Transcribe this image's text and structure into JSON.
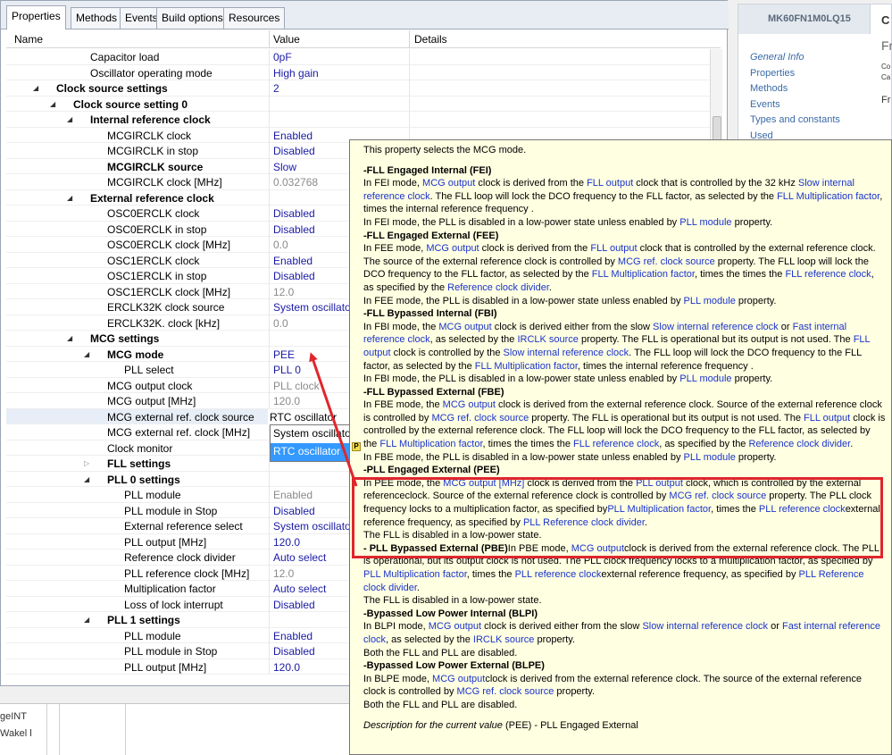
{
  "tabs": [
    "Properties",
    "Methods",
    "Events",
    "Build options",
    "Resources"
  ],
  "columns": {
    "name": "Name",
    "value": "Value",
    "details": "Details"
  },
  "rows": [
    {
      "name": "Capacitor load",
      "value": "0pF",
      "indent": 96,
      "tri": "",
      "bold": false,
      "gray": false
    },
    {
      "name": "Oscillator operating mode",
      "value": "High gain",
      "indent": 96,
      "tri": "",
      "bold": false,
      "gray": false
    },
    {
      "name": "Clock source settings",
      "value": "2",
      "indent": 58,
      "tri": "open",
      "bold": true,
      "gray": false
    },
    {
      "name": "Clock source setting 0",
      "value": "",
      "indent": 77,
      "tri": "open",
      "bold": true,
      "gray": false
    },
    {
      "name": "Internal reference clock",
      "value": "",
      "indent": 96,
      "tri": "open",
      "bold": true,
      "gray": false
    },
    {
      "name": "MCGIRCLK clock",
      "value": "Enabled",
      "indent": 115,
      "tri": "",
      "bold": false,
      "gray": false
    },
    {
      "name": "MCGIRCLK in stop",
      "value": "Disabled",
      "indent": 115,
      "tri": "",
      "bold": false,
      "gray": false
    },
    {
      "name": "MCGIRCLK source",
      "value": "Slow",
      "indent": 115,
      "tri": "",
      "bold": true,
      "gray": false
    },
    {
      "name": "MCGIRCLK clock [MHz]",
      "value": "0.032768",
      "indent": 115,
      "tri": "",
      "bold": false,
      "gray": true
    },
    {
      "name": "External reference clock",
      "value": "",
      "indent": 96,
      "tri": "open",
      "bold": true,
      "gray": false
    },
    {
      "name": "OSC0ERCLK clock",
      "value": "Disabled",
      "indent": 115,
      "tri": "",
      "bold": false,
      "gray": false
    },
    {
      "name": "OSC0ERCLK in stop",
      "value": "Disabled",
      "indent": 115,
      "tri": "",
      "bold": false,
      "gray": false
    },
    {
      "name": "OSC0ERCLK clock [MHz]",
      "value": "0.0",
      "indent": 115,
      "tri": "",
      "bold": false,
      "gray": true
    },
    {
      "name": "OSC1ERCLK clock",
      "value": "Enabled",
      "indent": 115,
      "tri": "",
      "bold": false,
      "gray": false
    },
    {
      "name": "OSC1ERCLK in stop",
      "value": "Disabled",
      "indent": 115,
      "tri": "",
      "bold": false,
      "gray": false
    },
    {
      "name": "OSC1ERCLK clock [MHz]",
      "value": "12.0",
      "indent": 115,
      "tri": "",
      "bold": false,
      "gray": true
    },
    {
      "name": "ERCLK32K clock source",
      "value": "System oscillator",
      "indent": 115,
      "tri": "",
      "bold": false,
      "gray": false
    },
    {
      "name": "ERCLK32K. clock [kHz]",
      "value": "0.0",
      "indent": 115,
      "tri": "",
      "bold": false,
      "gray": true
    },
    {
      "name": "MCG settings",
      "value": "",
      "indent": 96,
      "tri": "open",
      "bold": true,
      "gray": false
    },
    {
      "name": "MCG mode",
      "value": "PEE",
      "indent": 115,
      "tri": "open",
      "bold": true,
      "gray": false
    },
    {
      "name": "PLL select",
      "value": "PLL 0",
      "indent": 134,
      "tri": "",
      "bold": false,
      "gray": false
    },
    {
      "name": "MCG output clock",
      "value": "PLL clock",
      "indent": 115,
      "tri": "",
      "bold": false,
      "gray": true
    },
    {
      "name": "MCG output [MHz]",
      "value": "120.0",
      "indent": 115,
      "tri": "",
      "bold": false,
      "gray": true
    },
    {
      "name": "MCG external ref. clock source",
      "value": "",
      "indent": 115,
      "tri": "",
      "bold": false,
      "gray": false
    },
    {
      "name": "MCG external ref. clock [MHz]",
      "value": "",
      "indent": 115,
      "tri": "",
      "bold": false,
      "gray": false
    },
    {
      "name": "Clock monitor",
      "value": "",
      "indent": 115,
      "tri": "",
      "bold": false,
      "gray": false
    },
    {
      "name": "FLL settings",
      "value": "",
      "indent": 115,
      "tri": "closed",
      "bold": true,
      "gray": false
    },
    {
      "name": "PLL 0 settings",
      "value": "",
      "indent": 115,
      "tri": "open",
      "bold": true,
      "gray": false
    },
    {
      "name": "PLL module",
      "value": "Enabled",
      "indent": 134,
      "tri": "",
      "bold": false,
      "gray": true
    },
    {
      "name": "PLL module in Stop",
      "value": "Disabled",
      "indent": 134,
      "tri": "",
      "bold": false,
      "gray": false
    },
    {
      "name": "External reference select",
      "value": "System oscillator",
      "indent": 134,
      "tri": "",
      "bold": false,
      "gray": false
    },
    {
      "name": "PLL output [MHz]",
      "value": "120.0",
      "indent": 134,
      "tri": "",
      "bold": false,
      "gray": false
    },
    {
      "name": "Reference clock divider",
      "value": "Auto select",
      "indent": 134,
      "tri": "",
      "bold": false,
      "gray": false
    },
    {
      "name": "PLL reference clock [MHz]",
      "value": "12.0",
      "indent": 134,
      "tri": "",
      "bold": false,
      "gray": true
    },
    {
      "name": "Multiplication factor",
      "value": "Auto select",
      "indent": 134,
      "tri": "",
      "bold": false,
      "gray": false
    },
    {
      "name": "Loss of lock interrupt",
      "value": "Disabled",
      "indent": 134,
      "tri": "",
      "bold": false,
      "gray": false
    },
    {
      "name": "PLL 1 settings",
      "value": "",
      "indent": 115,
      "tri": "open",
      "bold": true,
      "gray": false
    },
    {
      "name": "PLL module",
      "value": "Enabled",
      "indent": 134,
      "tri": "",
      "bold": false,
      "gray": false
    },
    {
      "name": "PLL module in Stop",
      "value": "Disabled",
      "indent": 134,
      "tri": "",
      "bold": false,
      "gray": false
    },
    {
      "name": "PLL output [MHz]",
      "value": "120.0",
      "indent": 134,
      "tri": "",
      "bold": false,
      "gray": false
    }
  ],
  "editor": {
    "current": "RTC oscillator",
    "options": [
      "System oscillator",
      "RTC oscillator"
    ]
  },
  "bottom_panel": {
    "line1": "geINT",
    "line2": "Wakel l"
  },
  "right_panel": {
    "component": "MK60FN1M0LQ15",
    "tab_initial": "C",
    "right_text": [
      "Fr",
      "Co",
      "Ca",
      "Fr"
    ],
    "links": [
      "General Info",
      "Properties",
      "Methods",
      "Events",
      "Types and constants",
      "Used"
    ]
  },
  "tooltip": {
    "badge": "P",
    "intro": "This property selects the MCG mode.",
    "footer_label": "Description for the current value",
    "footer_value": " (PEE) - PLL Engaged External",
    "sections": [
      {
        "title": "-FLL Engaged Internal (FEI)",
        "inline": false,
        "body": [
          [
            {
              "t": "In FEI mode, "
            },
            {
              "t": "MCG output",
              "l": 1
            },
            {
              "t": " clock is derived from the "
            },
            {
              "t": "FLL output",
              "l": 1
            },
            {
              "t": " clock that is controlled by the 32 kHz "
            },
            {
              "t": "Slow internal reference clock",
              "l": 1
            },
            {
              "t": ". The FLL loop will lock the DCO frequency to the FLL factor, as selected by the "
            },
            {
              "t": "FLL Multiplication factor",
              "l": 1
            },
            {
              "t": ", times the internal reference frequency ."
            }
          ],
          [
            {
              "t": "In FEI mode, the PLL is disabled in a low-power state unless enabled by "
            },
            {
              "t": "PLL module",
              "l": 1
            },
            {
              "t": " property."
            }
          ]
        ]
      },
      {
        "title": "-FLL Engaged External (FEE)",
        "inline": false,
        "body": [
          [
            {
              "t": "In FEE mode, "
            },
            {
              "t": "MCG output",
              "l": 1
            },
            {
              "t": " clock is derived from the "
            },
            {
              "t": "FLL output",
              "l": 1
            },
            {
              "t": " clock that is controlled by the external reference clock. The source of the external reference clock is controlled by "
            },
            {
              "t": "MCG ref. clock source",
              "l": 1
            },
            {
              "t": " property. The FLL loop will lock the DCO frequency to the FLL factor, as selected by the "
            },
            {
              "t": "FLL Multiplication factor",
              "l": 1
            },
            {
              "t": ", times the times the "
            },
            {
              "t": "FLL reference clock",
              "l": 1
            },
            {
              "t": ", as specified by the "
            },
            {
              "t": "Reference clock divider",
              "l": 1
            },
            {
              "t": "."
            }
          ],
          [
            {
              "t": "In FEE mode, the PLL is disabled in a low-power state unless enabled by "
            },
            {
              "t": "PLL module",
              "l": 1
            },
            {
              "t": " property."
            }
          ]
        ]
      },
      {
        "title": "-FLL Bypassed Internal (FBI)",
        "inline": false,
        "body": [
          [
            {
              "t": "In FBI mode, the "
            },
            {
              "t": "MCG output",
              "l": 1
            },
            {
              "t": " clock is derived either from the slow "
            },
            {
              "t": "Slow internal reference clock",
              "l": 1
            },
            {
              "t": " or "
            },
            {
              "t": "Fast internal reference clock",
              "l": 1
            },
            {
              "t": ", as selected by the "
            },
            {
              "t": "IRCLK source",
              "l": 1
            },
            {
              "t": " property. The FLL is operational but its output is not used. The "
            },
            {
              "t": "FLL output",
              "l": 1
            },
            {
              "t": " clock is controlled by the "
            },
            {
              "t": "Slow internal reference clock",
              "l": 1
            },
            {
              "t": ". The FLL loop will lock the DCO frequency to the FLL factor, as selected by the "
            },
            {
              "t": "FLL Multiplication factor",
              "l": 1
            },
            {
              "t": ", times the internal reference frequency ."
            }
          ],
          [
            {
              "t": "In FBI mode, the PLL is disabled in a low-power state unless enabled by "
            },
            {
              "t": "PLL module",
              "l": 1
            },
            {
              "t": " property."
            }
          ]
        ]
      },
      {
        "title": "-FLL Bypassed External (FBE)",
        "inline": false,
        "body": [
          [
            {
              "t": "In FBE mode, the "
            },
            {
              "t": "MCG output",
              "l": 1
            },
            {
              "t": " clock is derived from the external reference clock. Source of the external reference clock is controlled by "
            },
            {
              "t": "MCG ref. clock source",
              "l": 1
            },
            {
              "t": " property. The FLL is operational but its output is not used. The "
            },
            {
              "t": "FLL output",
              "l": 1
            },
            {
              "t": " clock is controlled by the external reference clock. The FLL loop will lock the DCO frequency to the FLL factor, as selected by the "
            },
            {
              "t": "FLL Multiplication factor",
              "l": 1
            },
            {
              "t": ", times the times the "
            },
            {
              "t": "FLL reference clock",
              "l": 1
            },
            {
              "t": ", as specified by the "
            },
            {
              "t": "Reference clock divider",
              "l": 1
            },
            {
              "t": "."
            }
          ],
          [
            {
              "t": "In FBE mode, the PLL is disabled in a low-power state unless enabled by "
            },
            {
              "t": "PLL module",
              "l": 1
            },
            {
              "t": " property."
            }
          ]
        ]
      },
      {
        "title": "-PLL Engaged External (PEE)",
        "inline": false,
        "body": [
          [
            {
              "t": "In PEE mode, the "
            },
            {
              "t": "MCG output [MHz]",
              "l": 1
            },
            {
              "t": " clock is derived from the "
            },
            {
              "t": "PLL output",
              "l": 1
            },
            {
              "t": " clock, which is controlled by the external referenceclock. Source of the external reference clock is controlled by "
            },
            {
              "t": "MCG ref. clock source",
              "l": 1
            },
            {
              "t": " property. The PLL clock frequency locks to a multiplication factor, as specified by"
            },
            {
              "t": "PLL Multiplication factor",
              "l": 1
            },
            {
              "t": ", times the "
            },
            {
              "t": "PLL reference clock",
              "l": 1
            },
            {
              "t": "external reference frequency, as specified by "
            },
            {
              "t": "PLL Reference clock divider",
              "l": 1
            },
            {
              "t": "."
            }
          ],
          [
            {
              "t": "The FLL is disabled in a low-power state."
            }
          ]
        ]
      },
      {
        "title": "- PLL Bypassed External (PBE)",
        "inline": true,
        "body": [
          [
            {
              "t": "In PBE mode, "
            },
            {
              "t": "MCG output",
              "l": 1
            },
            {
              "t": "clock is derived from the external reference clock. The PLL is operational, but its output clock is not used. The PLL clock frequency locks to a multiplication factor, as specified by "
            },
            {
              "t": "PLL Multiplication factor",
              "l": 1
            },
            {
              "t": ", times the "
            },
            {
              "t": "PLL reference clock",
              "l": 1
            },
            {
              "t": "external reference frequency, as specified by "
            },
            {
              "t": "PLL Reference clock divider",
              "l": 1
            },
            {
              "t": "."
            }
          ],
          [
            {
              "t": "The FLL is disabled in a low-power state."
            }
          ]
        ]
      },
      {
        "title": "-Bypassed Low Power Internal (BLPI)",
        "inline": false,
        "body": [
          [
            {
              "t": "In BLPI mode, "
            },
            {
              "t": "MCG output",
              "l": 1
            },
            {
              "t": " clock is derived either from the slow "
            },
            {
              "t": "Slow internal reference clock",
              "l": 1
            },
            {
              "t": " or "
            },
            {
              "t": "Fast internal reference clock",
              "l": 1
            },
            {
              "t": ", as selected by the "
            },
            {
              "t": "IRCLK source",
              "l": 1
            },
            {
              "t": " property."
            }
          ],
          [
            {
              "t": "Both the FLL and PLL are disabled."
            }
          ]
        ]
      },
      {
        "title": "-Bypassed Low Power External (BLPE)",
        "inline": false,
        "body": [
          [
            {
              "t": "In BLPE mode, "
            },
            {
              "t": "MCG output",
              "l": 1
            },
            {
              "t": "clock is derived from the external reference clock. The source of the external reference clock is controlled by "
            },
            {
              "t": "MCG ref. clock source",
              "l": 1
            },
            {
              "t": " property."
            }
          ],
          [
            {
              "t": "Both the FLL and PLL are disabled."
            }
          ]
        ]
      }
    ]
  },
  "colors": {
    "link": "#1a33cc",
    "highlight": "#e0262d",
    "tooltip_bg": "#ffffe1",
    "value_text": "#1a1aa6"
  }
}
